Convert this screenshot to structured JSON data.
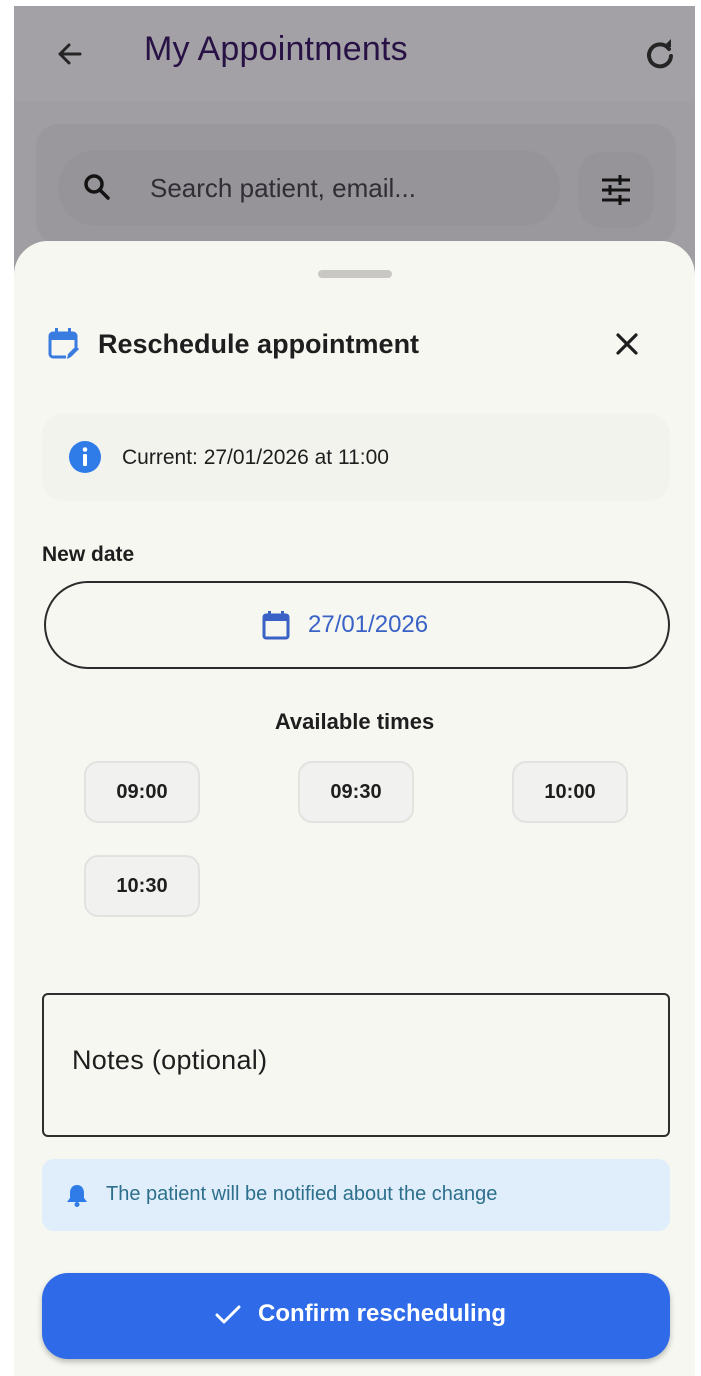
{
  "app_bar": {
    "title": "My Appointments",
    "back_icon": "arrow-left-icon",
    "refresh_icon": "refresh-icon"
  },
  "search": {
    "placeholder": "Search patient, email...",
    "icon": "search-icon",
    "filter_icon": "tune-icon"
  },
  "sheet": {
    "title": "Reschedule appointment",
    "title_icon": "calendar-edit-icon",
    "close_icon": "close-icon",
    "current_info": "Current: 27/01/2026 at 11:00",
    "new_date_label": "New date",
    "selected_date": "27/01/2026",
    "available_times_label": "Available times",
    "time_slots": [
      "09:00",
      "09:30",
      "10:00",
      "10:30"
    ],
    "notes_placeholder": "Notes (optional)",
    "notification": "The patient will be notified about the change",
    "confirm_label": "Confirm rescheduling"
  },
  "colors": {
    "primary": "#2f6ae8",
    "date_text": "#3a62c6",
    "notice_bg": "#dfeefa",
    "notice_text": "#2d6f8c",
    "sheet_bg": "#f7f7f2"
  }
}
